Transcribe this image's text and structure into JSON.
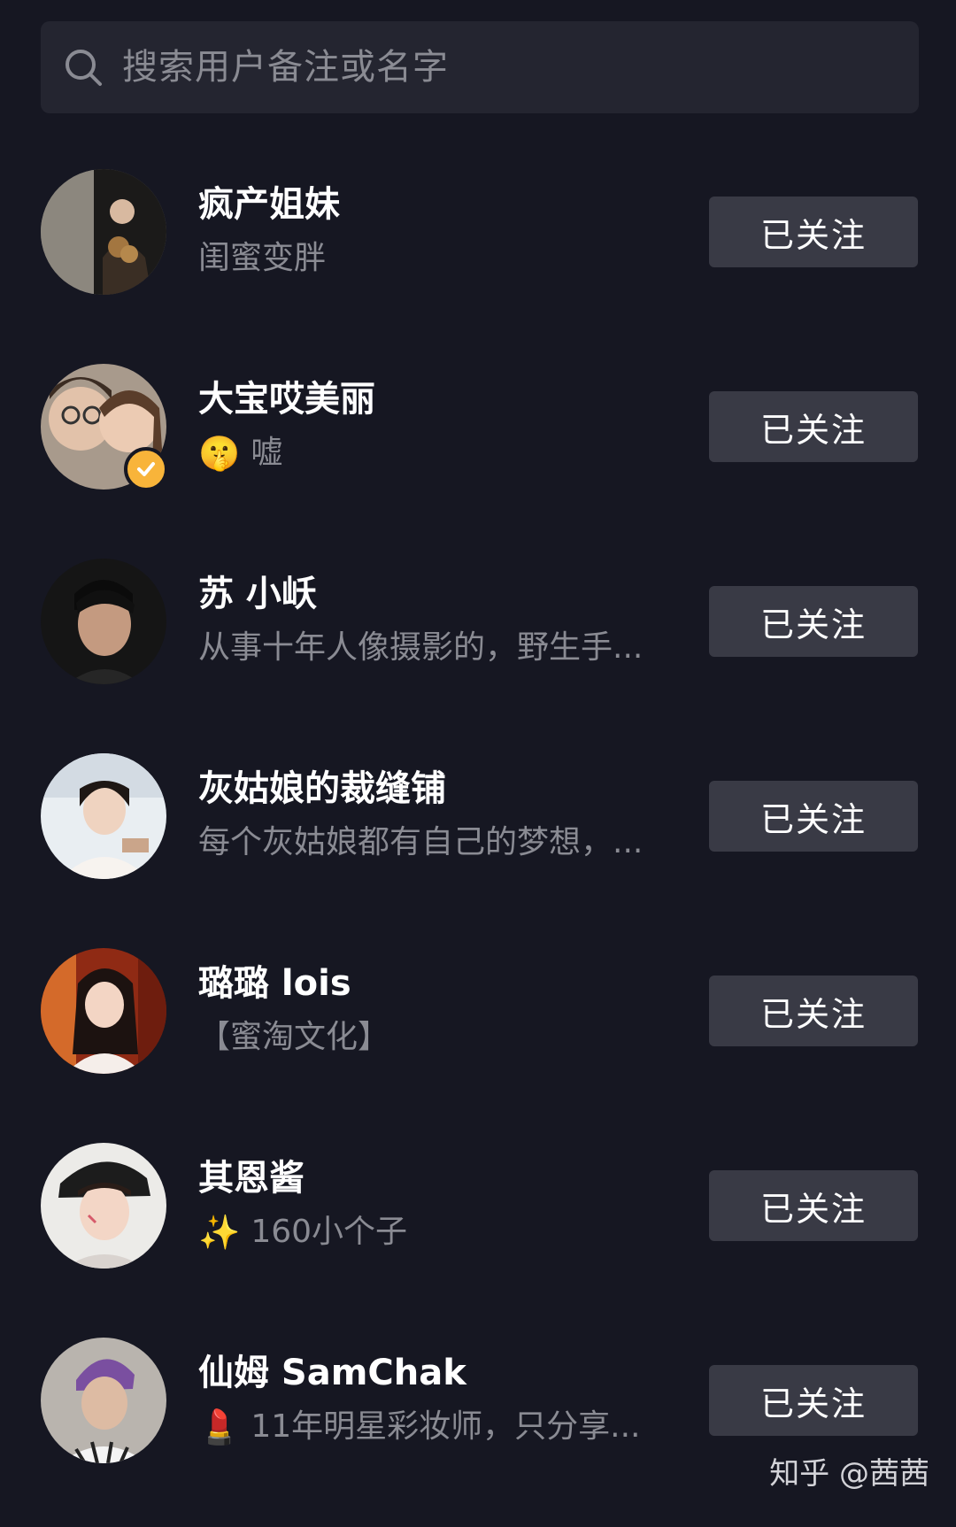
{
  "search": {
    "placeholder": "搜索用户备注或名字"
  },
  "follow_label": "已关注",
  "users": [
    {
      "name": "疯产姐妹",
      "desc_emoji": "",
      "desc": "闺蜜变胖",
      "verified": false,
      "follow_label": "已关注"
    },
    {
      "name": "大宝哎美丽",
      "desc_emoji": "🤫",
      "desc": "嘘",
      "verified": true,
      "follow_label": "已关注"
    },
    {
      "name": "苏 小岆",
      "desc_emoji": "",
      "desc": "从事十年人像摄影的，野生手...",
      "verified": false,
      "follow_label": "已关注"
    },
    {
      "name": "灰姑娘的裁缝铺",
      "desc_emoji": "",
      "desc": "每个灰姑娘都有自己的梦想，...",
      "verified": false,
      "follow_label": "已关注"
    },
    {
      "name": "璐璐 lois",
      "desc_emoji": "",
      "desc": "【蜜淘文化】",
      "verified": false,
      "follow_label": "已关注"
    },
    {
      "name": "其恩酱",
      "desc_emoji": "✨",
      "desc": "160小个子",
      "verified": false,
      "follow_label": "已关注"
    },
    {
      "name": "仙姆 SamChak",
      "desc_emoji": "💄",
      "desc": "11年明星彩妆师，只分享...",
      "verified": false,
      "follow_label": "已关注"
    }
  ],
  "watermark": "知乎 @茜茜",
  "colors": {
    "background": "#161722",
    "search_bg": "#242530",
    "button_bg": "#393a45",
    "secondary_text": "#8a8b93",
    "verified_badge": "#f8b43a"
  }
}
